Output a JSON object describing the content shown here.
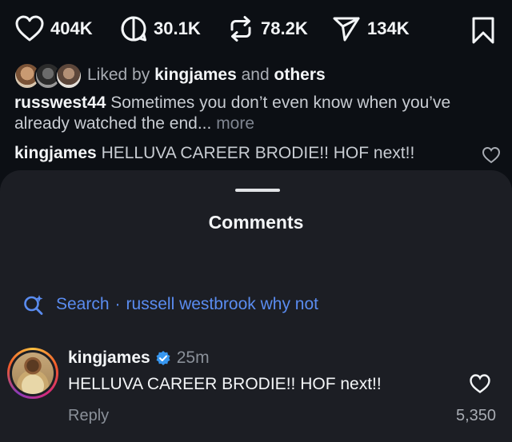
{
  "actions": {
    "likes": "404K",
    "comments": "30.1K",
    "reposts": "78.2K",
    "shares": "134K"
  },
  "liked_by": {
    "prefix": "Liked by",
    "user": "kingjames",
    "conj": "and",
    "others": "others"
  },
  "caption": {
    "user": "russwest44",
    "text": "Sometimes you don’t even know when you’ve already watched the end...",
    "more": "more"
  },
  "comment_preview": {
    "user": "kingjames",
    "text": "HELLUVA CAREER BRODIE!! HOF next!!"
  },
  "sheet": {
    "title": "Comments",
    "search_label": "Search",
    "search_separator": "·",
    "search_query": "russell westbrook why not"
  },
  "comment": {
    "user": "kingjames",
    "time": "25m",
    "text": "HELLUVA CAREER BRODIE!! HOF next!!",
    "reply": "Reply",
    "likes": "5,350"
  },
  "colors": {
    "background": "#0c0f14",
    "sheet": "#1c1e24",
    "accent_link": "#5a8cf0",
    "verified": "#3797f0"
  }
}
